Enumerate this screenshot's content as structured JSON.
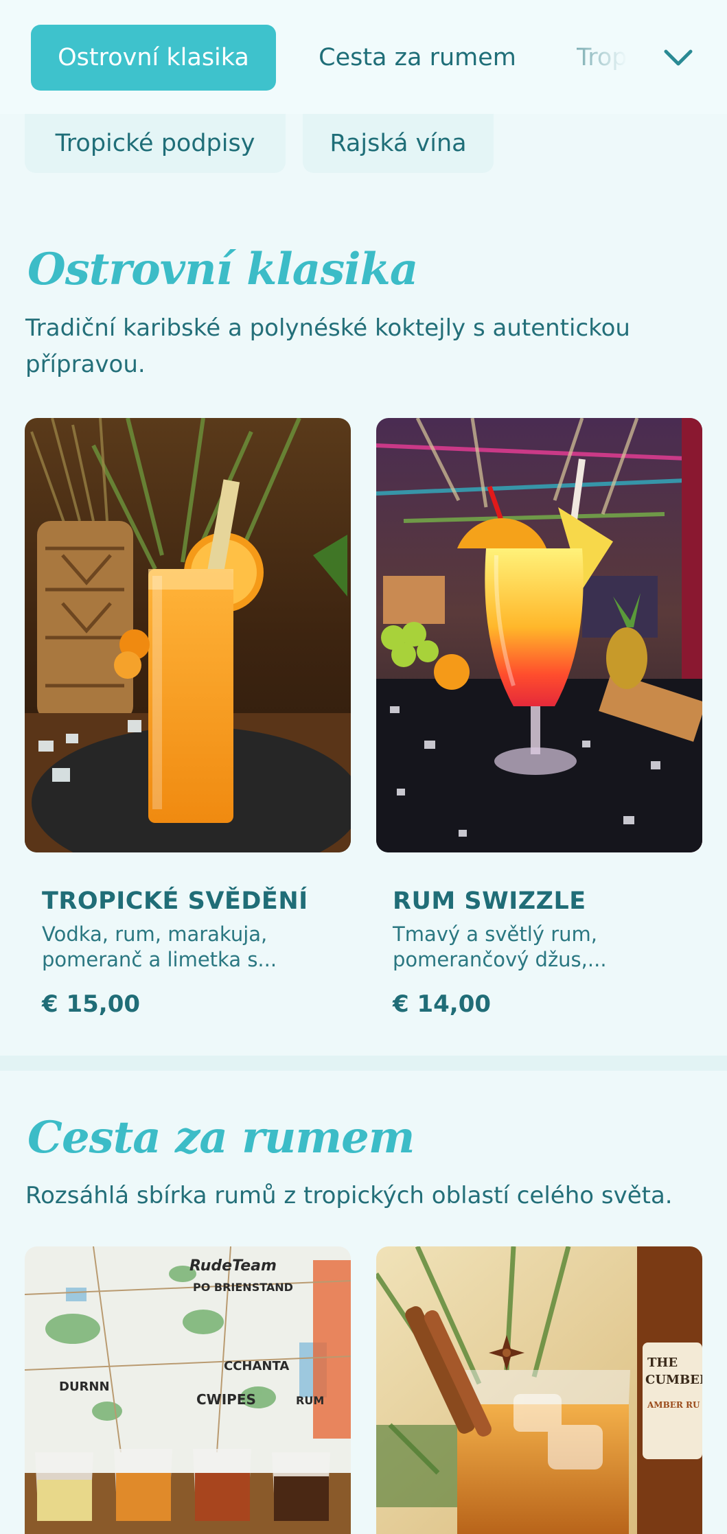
{
  "categories": {
    "tabs": [
      {
        "label": "Ostrovní klasika",
        "active": true
      },
      {
        "label": "Cesta za rumem",
        "active": false
      },
      {
        "label": "Trop",
        "active": false
      }
    ],
    "chips": [
      {
        "label": "Tropické podpisy"
      },
      {
        "label": "Rajská vína"
      }
    ],
    "more_icon": "chevron-down-icon"
  },
  "sections": [
    {
      "title": "Ostrovní klasika",
      "description": "Tradiční karibské a polynéské koktejly s autentickou přípravou.",
      "items": [
        {
          "name": "TROPICKÉ SVĚDĚNÍ",
          "description": "Vodka, rum, marakuja, pomeranč a limetka s...",
          "price": "€ 15,00"
        },
        {
          "name": "RUM SWIZZLE",
          "description": "Tmavý a světlý rum, pomerančový džus,...",
          "price": "€ 14,00"
        }
      ]
    },
    {
      "title": "Cesta za rumem",
      "description": "Rozsáhlá sbírka rumů z tropických oblastí celého světa.",
      "items": [
        {
          "image_text": [
            "RudeTeam",
            "PO BRIENSTAND",
            "CCHANTA",
            "CWIPES",
            "DURNN",
            "RUM"
          ]
        },
        {
          "image_text": [
            "THE",
            "CUMBERO",
            "AMBER RU"
          ]
        }
      ]
    }
  ],
  "colors": {
    "accent": "#3ec2cc",
    "title": "#3cbcc7",
    "text": "#1f6e78",
    "background": "#eef9fa"
  }
}
